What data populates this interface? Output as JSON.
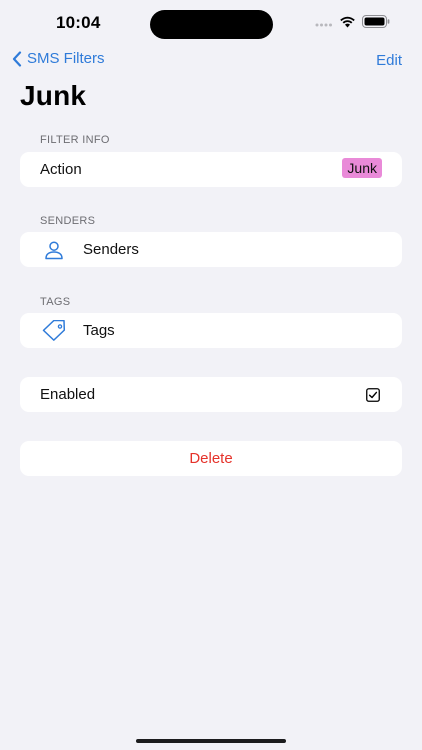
{
  "status_bar": {
    "time": "10:04",
    "icons": [
      "cellular-icon",
      "wifi-icon",
      "battery-icon"
    ]
  },
  "nav": {
    "back_label": "SMS Filters",
    "edit_label": "Edit"
  },
  "page_title": "Junk",
  "sections": {
    "filter_info": {
      "header": "FILTER INFO",
      "action_label": "Action",
      "action_value": "Junk"
    },
    "senders": {
      "header": "SENDERS",
      "label": "Senders",
      "icon": "person-icon"
    },
    "tags": {
      "header": "TAGS",
      "label": "Tags",
      "icon": "tag-icon"
    },
    "enabled": {
      "label": "Enabled",
      "checked": true
    },
    "delete": {
      "label": "Delete"
    }
  },
  "colors": {
    "accent": "#2f7bd9",
    "badge": "#e98ad8",
    "destructive": "#e5322a",
    "background": "#f2f2f7"
  }
}
